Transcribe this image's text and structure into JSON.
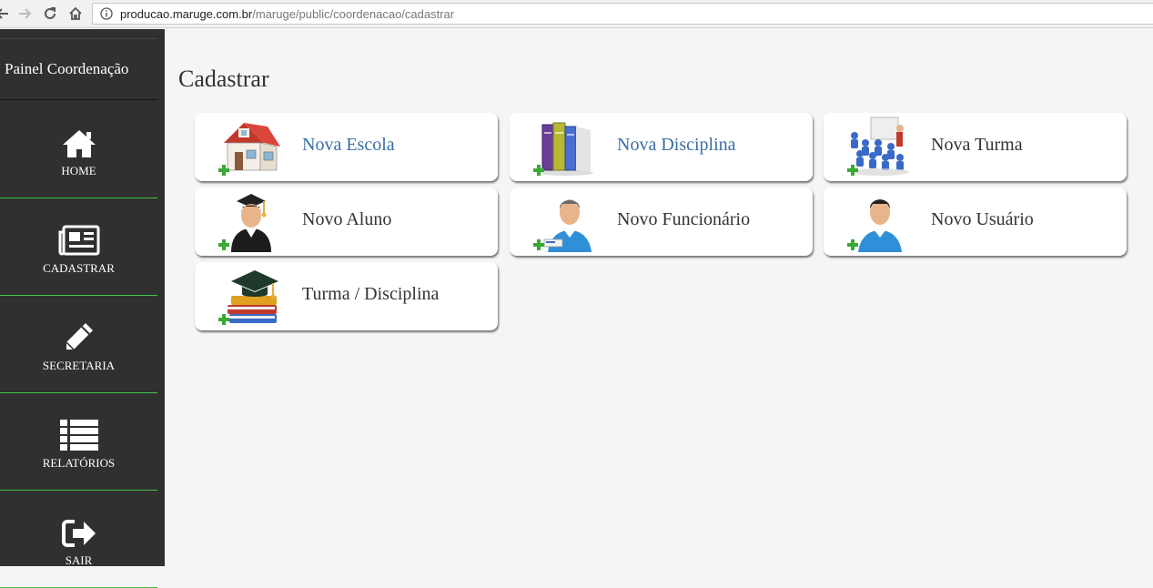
{
  "browser": {
    "url_host": "producao.maruge.com.br",
    "url_path": "/maruge/public/coordenacao/cadastrar"
  },
  "sidebar": {
    "title": "Painel Coordenação",
    "items": [
      {
        "label": "HOME",
        "icon": "home-icon"
      },
      {
        "label": "CADASTRAR",
        "icon": "newspaper-icon"
      },
      {
        "label": "SECRETARIA",
        "icon": "pencil-icon"
      },
      {
        "label": "RELATÓRIOS",
        "icon": "list-icon"
      },
      {
        "label": "SAIR",
        "icon": "sign-out-icon"
      }
    ]
  },
  "main": {
    "title": "Cadastrar",
    "cards": [
      {
        "label": "Nova Escola",
        "icon": "school-house-icon"
      },
      {
        "label": "Nova Disciplina",
        "icon": "books-icon"
      },
      {
        "label": "Nova Turma",
        "icon": "classroom-icon"
      },
      {
        "label": "Novo Aluno",
        "icon": "student-graduate-icon"
      },
      {
        "label": "Novo Funcionário",
        "icon": "employee-icon"
      },
      {
        "label": "Novo Usuário",
        "icon": "user-icon"
      },
      {
        "label": "Turma / Disciplina",
        "icon": "graduation-books-icon"
      }
    ]
  },
  "colors": {
    "sidebar_bg": "#303030",
    "divider_green": "#3fc24a",
    "link_blue": "#3a6ea5",
    "plus_green": "#3aa935"
  }
}
